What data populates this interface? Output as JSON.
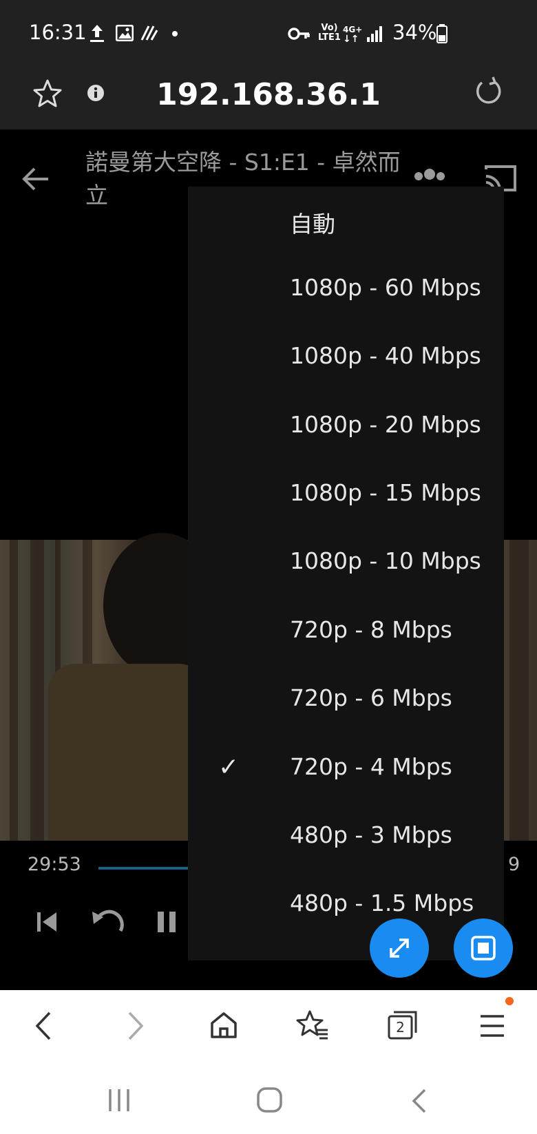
{
  "status_bar": {
    "time": "16:31",
    "network_label_top": "Vo)",
    "network_label_bottom": "LTE1",
    "data_label": "4G+",
    "battery_percent": "34%"
  },
  "address_bar": {
    "url": "192.168.36.1"
  },
  "player": {
    "title": "諾曼第大空降 - S1:E1 - 卓然而立",
    "current_time": "29:53",
    "total_time_visible": "9"
  },
  "quality_menu": {
    "items": [
      {
        "label": "自動",
        "check": ""
      },
      {
        "label": "1080p - 60 Mbps",
        "check": ""
      },
      {
        "label": "1080p - 40 Mbps",
        "check": ""
      },
      {
        "label": "1080p - 20 Mbps",
        "check": ""
      },
      {
        "label": "1080p - 15 Mbps",
        "check": ""
      },
      {
        "label": "1080p - 10 Mbps",
        "check": ""
      },
      {
        "label": "720p - 8 Mbps",
        "check": ""
      },
      {
        "label": "720p - 6 Mbps",
        "check": ""
      },
      {
        "label": "720p - 4 Mbps",
        "check": "✓"
      },
      {
        "label": "480p - 3 Mbps",
        "check": ""
      },
      {
        "label": "480p - 1.5 Mbps",
        "check": ""
      }
    ]
  },
  "browser_nav": {
    "tab_count": "2"
  },
  "colors": {
    "accent": "#1a8cf1",
    "progress": "#1d5f87",
    "notification": "#f4661b"
  }
}
